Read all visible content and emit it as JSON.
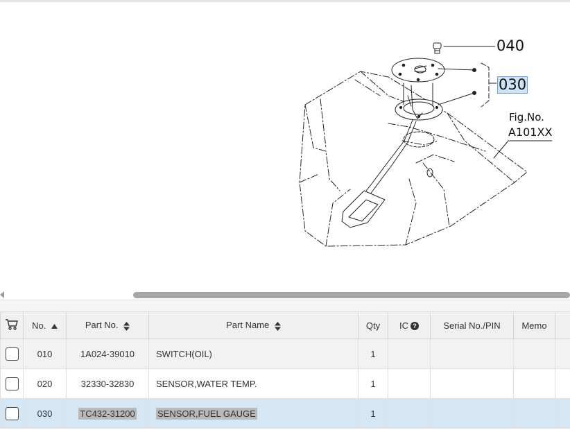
{
  "diagram": {
    "callouts": [
      {
        "id": "040",
        "label": "040"
      },
      {
        "id": "030",
        "label": "030"
      }
    ],
    "figure_label": "Fig.No.",
    "figure_code": "A101XX"
  },
  "table": {
    "headers": {
      "cart": "cart-icon",
      "no": "No.",
      "part_no": "Part No.",
      "part_name": "Part Name",
      "qty": "Qty",
      "ic": "IC",
      "serial": "Serial No./PIN",
      "memo": "Memo"
    },
    "rows": [
      {
        "no": "010",
        "part_no": "1A024-39010",
        "part_name": "SWITCH(OIL)",
        "qty": "1",
        "ic": "",
        "serial": "",
        "memo": "",
        "selected": false
      },
      {
        "no": "020",
        "part_no": "32330-32830",
        "part_name": "SENSOR,WATER TEMP.",
        "qty": "1",
        "ic": "",
        "serial": "",
        "memo": "",
        "selected": false
      },
      {
        "no": "030",
        "part_no": "TC432-31200",
        "part_name": "SENSOR,FUEL GAUGE",
        "qty": "1",
        "ic": "",
        "serial": "",
        "memo": "",
        "selected": true
      }
    ]
  },
  "colors": {
    "selected_row": "#d5e6f5",
    "alt_row": "#f2f2f2",
    "header_bg": "#eef0f1",
    "callout_highlight": "#cfe3f7"
  }
}
